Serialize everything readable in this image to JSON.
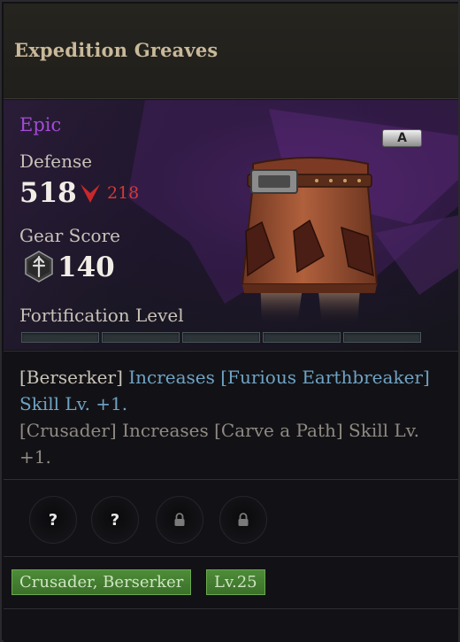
{
  "item": {
    "name": "Expedition Greaves",
    "rarity": "Epic",
    "grade": "A"
  },
  "stats": {
    "defense_label": "Defense",
    "defense_value": "518",
    "defense_diff": "218",
    "gear_score_label": "Gear Score",
    "gear_score_value": "140",
    "fortification_label": "Fortification Level",
    "fortification_level": 0,
    "fortification_max": 5
  },
  "effects": [
    {
      "class": "[Berserker]",
      "text": "Increases [Furious Earthbreaker] Skill Lv. +1."
    },
    {
      "class": "[Crusader]",
      "text": "Increases [Carve a Path] Skill Lv. +1."
    }
  ],
  "sockets": [
    {
      "state": "unknown",
      "symbol": "?"
    },
    {
      "state": "unknown",
      "symbol": "?"
    },
    {
      "state": "locked",
      "symbol": "lock-icon"
    },
    {
      "state": "locked",
      "symbol": "lock-icon"
    }
  ],
  "tags": {
    "classes": "Crusader, Berserker",
    "level": "Lv.25"
  },
  "colors": {
    "rarity_epic": "#a54ad6",
    "decrease": "#d23a3a",
    "highlight": "#6fa3c4",
    "tag_green": "#4d8c39"
  }
}
